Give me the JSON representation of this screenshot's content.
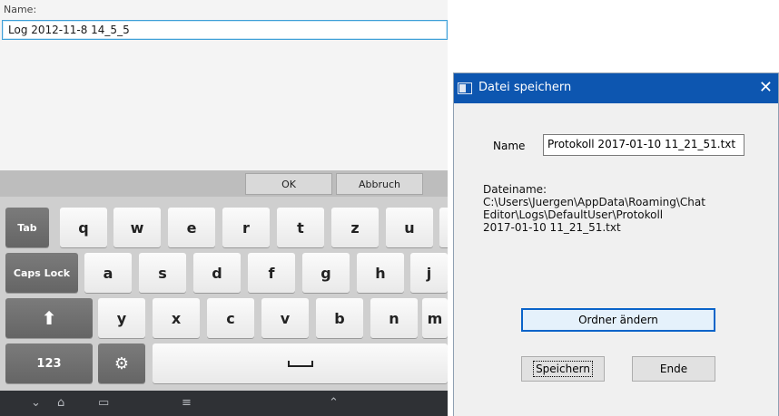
{
  "android": {
    "name_label": "Name:",
    "name_value": "Log 2012-11-8 14_5_5",
    "ok_label": "OK",
    "abbruch_label": "Abbruch",
    "row1": [
      "q",
      "w",
      "e",
      "r",
      "t",
      "z",
      "u"
    ],
    "row2": [
      "a",
      "s",
      "d",
      "f",
      "g",
      "h",
      "j"
    ],
    "row3": [
      "y",
      "x",
      "c",
      "v",
      "b",
      "n",
      "m"
    ],
    "tab_label": "Tab",
    "caps_label": "Caps Lock",
    "num_label": "123"
  },
  "dialog": {
    "title": "Datei speichern",
    "name_label": "Name",
    "name_value": "Protokoll 2017-01-10 11_21_51.txt",
    "dateiname_label": "Dateiname:",
    "path_lines": [
      "C:\\Users\\Juergen\\AppData\\Roaming\\Chat",
      "Editor\\Logs\\DefaultUser\\Protokoll",
      "2017-01-10 11_21_51.txt"
    ],
    "ordner_label": "Ordner ändern",
    "speichern_label": "Speichern",
    "ende_label": "Ende"
  }
}
